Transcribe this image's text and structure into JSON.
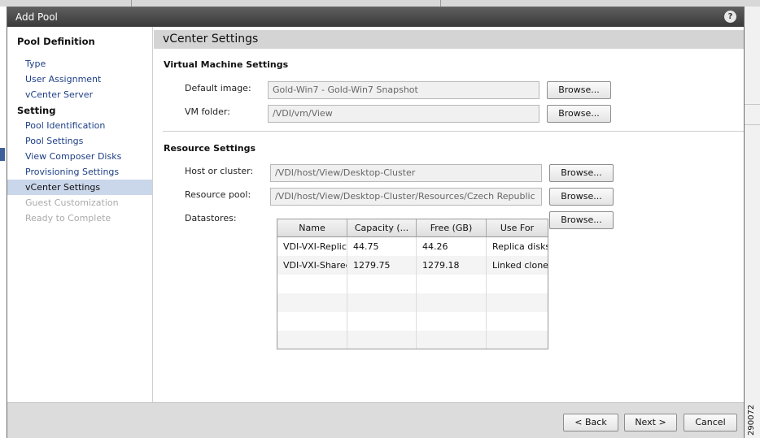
{
  "window": {
    "title": "Add Pool"
  },
  "sidebar": {
    "section1": "Pool Definition",
    "section1_items": [
      "Type",
      "User Assignment",
      "vCenter Server"
    ],
    "section2": "Setting",
    "section2_items": [
      "Pool Identification",
      "Pool Settings",
      "View Composer Disks",
      "Provisioning Settings",
      "vCenter Settings"
    ],
    "disabled_items": [
      "Guest Customization",
      "Ready to Complete"
    ],
    "selected": "vCenter Settings"
  },
  "main": {
    "title": "vCenter Settings",
    "vm_settings": {
      "heading": "Virtual Machine Settings",
      "default_image_label": "Default image:",
      "default_image_value": "Gold-Win7 - Gold-Win7 Snapshot",
      "vm_folder_label": "VM folder:",
      "vm_folder_value": "/VDI/vm/View"
    },
    "resource_settings": {
      "heading": "Resource Settings",
      "host_label": "Host or cluster:",
      "host_value": "/VDI/host/View/Desktop-Cluster",
      "pool_label": "Resource pool:",
      "pool_value": "/VDI/host/View/Desktop-Cluster/Resources/Czech Republic",
      "datastores_label": "Datastores:"
    },
    "browse_label": "Browse...",
    "datastores": {
      "columns": [
        "Name",
        "Capacity (...",
        "Free (GB)",
        "Use For"
      ],
      "rows": [
        [
          "VDI-VXI-Replica",
          "44.75",
          "44.26",
          "Replica disks"
        ],
        [
          "VDI-VXI-Shared",
          "1279.75",
          "1279.18",
          "Linked clones"
        ]
      ]
    }
  },
  "footer": {
    "back": "< Back",
    "next": "Next >",
    "cancel": "Cancel"
  },
  "figure_id": "290072",
  "colors": {
    "selected_bg": "#cad6ea",
    "link": "#1d3f86",
    "titlebar": "#4a4a4a"
  }
}
